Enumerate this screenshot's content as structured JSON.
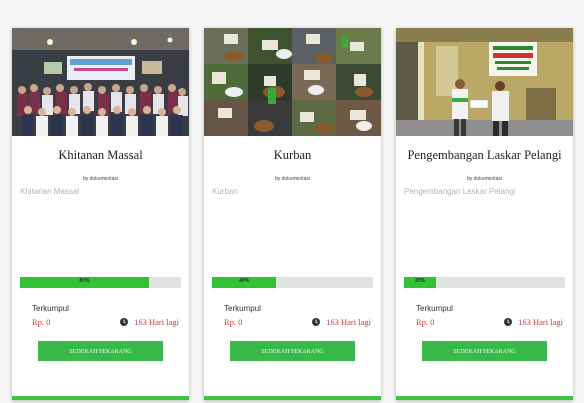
{
  "campaigns": [
    {
      "title": "Khitanan Massal",
      "author": "by dokumentasi",
      "description": "Khitanan Massal",
      "progress_label": "80%",
      "progress_fraction": 0.8,
      "collected_label": "Terkumpul",
      "amount": "Rp. 0",
      "days_left": "163 Hari lagi",
      "button_label": "SEDEKAH SEKARANG",
      "image": "group-photo"
    },
    {
      "title": "Kurban",
      "author": "by dokumentasi",
      "description": "Kurban",
      "progress_label": "40%",
      "progress_fraction": 0.4,
      "collected_label": "Terkumpul",
      "amount": "Rp. 0",
      "days_left": "163 Hari lagi",
      "button_label": "SEDEKAH SEKARANG",
      "image": "livestock-collage"
    },
    {
      "title": "Pengembangan Laskar Pelangi",
      "author": "by dokumentasi",
      "description": "Pengembangan Laskar Pelangi",
      "progress_label": "20%",
      "progress_fraction": 0.2,
      "collected_label": "Terkumpul",
      "amount": "Rp. 0",
      "days_left": "163 Hari lagi",
      "button_label": "SEDEKAH SEKARANG",
      "image": "handover-photo"
    }
  ],
  "colors": {
    "accent_green": "#33c233",
    "button_green": "#3bb84b",
    "amount_red": "#c23b3b",
    "track_gray": "#e2e2e2"
  }
}
